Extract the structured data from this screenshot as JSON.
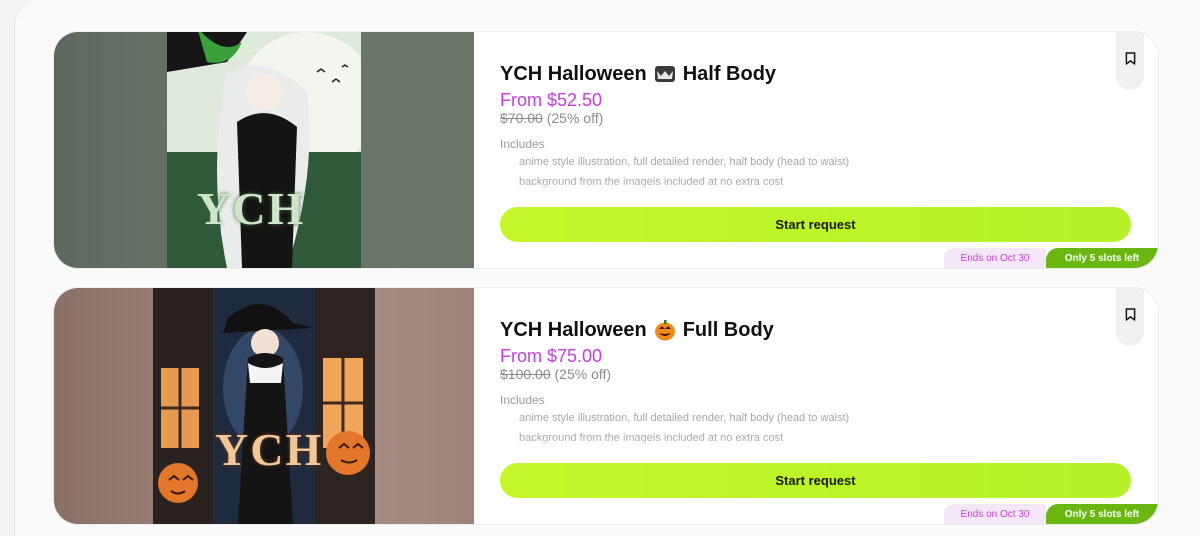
{
  "colors": {
    "price": "#c63ddb",
    "button": "#c5f62a",
    "slots_badge": "#6ab711",
    "ends_badge": "#f4e8f8"
  },
  "cards": [
    {
      "title": "YCH Halloween",
      "title_emoji": "bat-emoji",
      "title_suffix": "Half Body",
      "price": "From $52.50",
      "old_price": "$70.00",
      "discount": "(25% off)",
      "includes_label": "Includes",
      "includes": [
        "anime style illustration, full detailed render, half body (head to waist)",
        "background from the imageis included at no extra cost"
      ],
      "button": "Start request",
      "ends": "Ends on Oct 30",
      "slots": "Only 5 slots left",
      "image_text": "YCH",
      "icon": "bookmark-icon"
    },
    {
      "title": "YCH Halloween",
      "title_emoji": "jack-o-lantern-emoji",
      "title_suffix": "Full Body",
      "price": "From $75.00",
      "old_price": "$100.00",
      "discount": "(25% off)",
      "includes_label": "Includes",
      "includes": [
        "anime style illustration, full detailed render, half body (head to waist)",
        "background from the imageis included at no extra cost"
      ],
      "button": "Start request",
      "ends": "Ends on Oct 30",
      "slots": "Only 5 slots left",
      "image_text": "YCH",
      "icon": "bookmark-icon"
    }
  ]
}
